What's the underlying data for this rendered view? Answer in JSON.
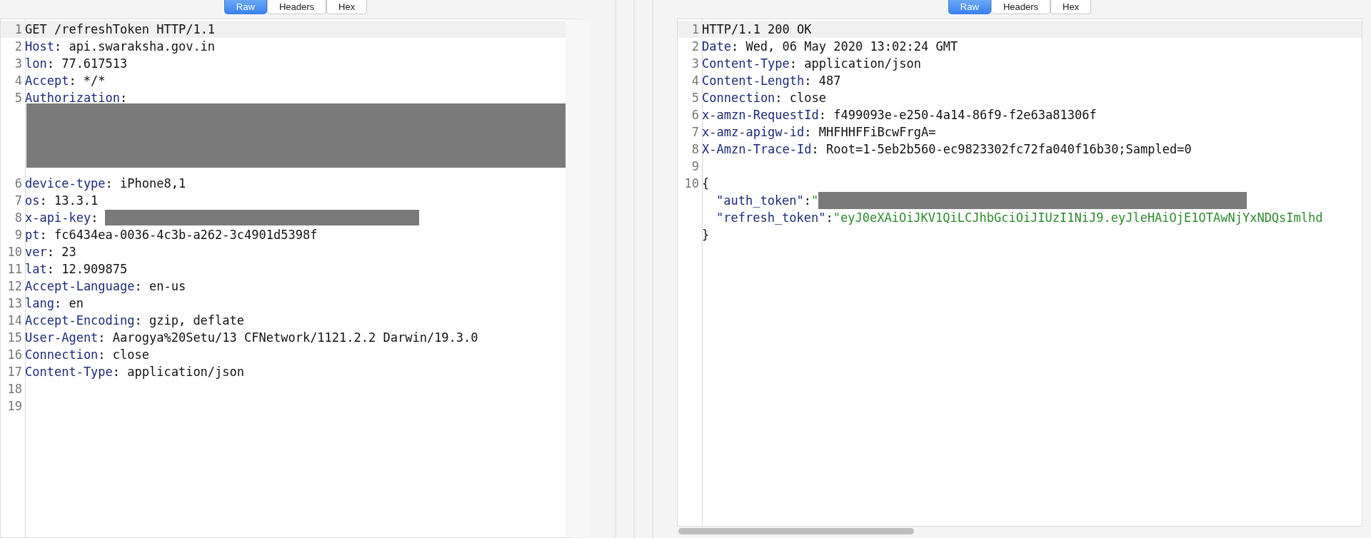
{
  "request": {
    "tabs": [
      {
        "label": "Raw",
        "selected": true
      },
      {
        "label": "Headers",
        "selected": false
      },
      {
        "label": "Hex",
        "selected": false
      }
    ],
    "lines": [
      {
        "number": "1",
        "kind": "text",
        "text": "GET /refreshToken HTTP/1.1",
        "current": true
      },
      {
        "number": "2",
        "kind": "header",
        "key": "Host",
        "colon": ":",
        "value": "api.swaraksha.gov.in"
      },
      {
        "number": "3",
        "kind": "header",
        "key": "lon",
        "colon": ":",
        "value": "77.617513"
      },
      {
        "number": "4",
        "kind": "header",
        "key": "Accept",
        "colon": ":",
        "value": "*/*"
      },
      {
        "number": "5",
        "kind": "wrapped_header",
        "key": "Authorization",
        "colon": ":",
        "redacted": true
      },
      {
        "number": "6",
        "kind": "header",
        "key": "device-type",
        "colon": ":",
        "value": "iPhone8,1"
      },
      {
        "number": "7",
        "kind": "header",
        "key": "os",
        "colon": ":",
        "value": "13.3.1"
      },
      {
        "number": "8",
        "kind": "header",
        "key": "x-api-key",
        "colon": ":",
        "redacted": true
      },
      {
        "number": "9",
        "kind": "header",
        "key": "pt",
        "colon": ":",
        "value": "fc6434ea-0036-4c3b-a262-3c4901d5398f"
      },
      {
        "number": "10",
        "kind": "header",
        "key": "ver",
        "colon": ":",
        "value": "23"
      },
      {
        "number": "11",
        "kind": "header",
        "key": "lat",
        "colon": ":",
        "value": "12.909875"
      },
      {
        "number": "12",
        "kind": "header",
        "key": "Accept-Language",
        "colon": ":",
        "value": "en-us"
      },
      {
        "number": "13",
        "kind": "header",
        "key": "lang",
        "colon": ":",
        "value": "en"
      },
      {
        "number": "14",
        "kind": "header",
        "key": "Accept-Encoding",
        "colon": ":",
        "value": "gzip, deflate"
      },
      {
        "number": "15",
        "kind": "header",
        "key": "User-Agent",
        "colon": ":",
        "value": "Aarogya%20Setu/13 CFNetwork/1121.2.2 Darwin/19.3.0"
      },
      {
        "number": "16",
        "kind": "header",
        "key": "Connection",
        "colon": ":",
        "value": "close"
      },
      {
        "number": "17",
        "kind": "header",
        "key": "Content-Type",
        "colon": ":",
        "value": "application/json"
      },
      {
        "number": "18",
        "kind": "blank"
      },
      {
        "number": "19",
        "kind": "blank"
      }
    ]
  },
  "response": {
    "tabs": [
      {
        "label": "Raw",
        "selected": true
      },
      {
        "label": "Headers",
        "selected": false
      },
      {
        "label": "Hex",
        "selected": false
      }
    ],
    "lines": [
      {
        "number": "1",
        "kind": "text",
        "text": "HTTP/1.1 200 OK",
        "current": true
      },
      {
        "number": "2",
        "kind": "header",
        "key": "Date",
        "colon": ":",
        "value": "Wed, 06 May 2020 13:02:24 GMT"
      },
      {
        "number": "3",
        "kind": "header",
        "key": "Content-Type",
        "colon": ":",
        "value": "application/json"
      },
      {
        "number": "4",
        "kind": "header",
        "key": "Content-Length",
        "colon": ":",
        "value": "487"
      },
      {
        "number": "5",
        "kind": "header",
        "key": "Connection",
        "colon": ":",
        "value": "close"
      },
      {
        "number": "6",
        "kind": "header",
        "key": "x-amzn-RequestId",
        "colon": ":",
        "value": "f499093e-e250-4a14-86f9-f2e63a81306f"
      },
      {
        "number": "7",
        "kind": "header",
        "key": "x-amz-apigw-id",
        "colon": ":",
        "value": "MHFHHFFiBcwFrgA="
      },
      {
        "number": "8",
        "kind": "header",
        "key": "X-Amzn-Trace-Id",
        "colon": ":",
        "value": "Root=1-5eb2b560-ec9823302fc72fa040f16b30;Sampled=0"
      },
      {
        "number": "9",
        "kind": "blank"
      },
      {
        "number": "10",
        "kind": "text",
        "text": "{"
      },
      {
        "kind": "json_field",
        "key": "\"auth_token\"",
        "colon": ":",
        "quote": "\"",
        "redacted": true
      },
      {
        "kind": "json_field",
        "key": "\"refresh_token\"",
        "colon": ":",
        "value": "\"eyJ0eXAiOiJKV1QiLCJhbGciOiJIUzI1NiJ9.eyJleHAiOjE1OTAwNjYxNDQsImlhd"
      },
      {
        "kind": "text",
        "text": "}"
      }
    ]
  }
}
